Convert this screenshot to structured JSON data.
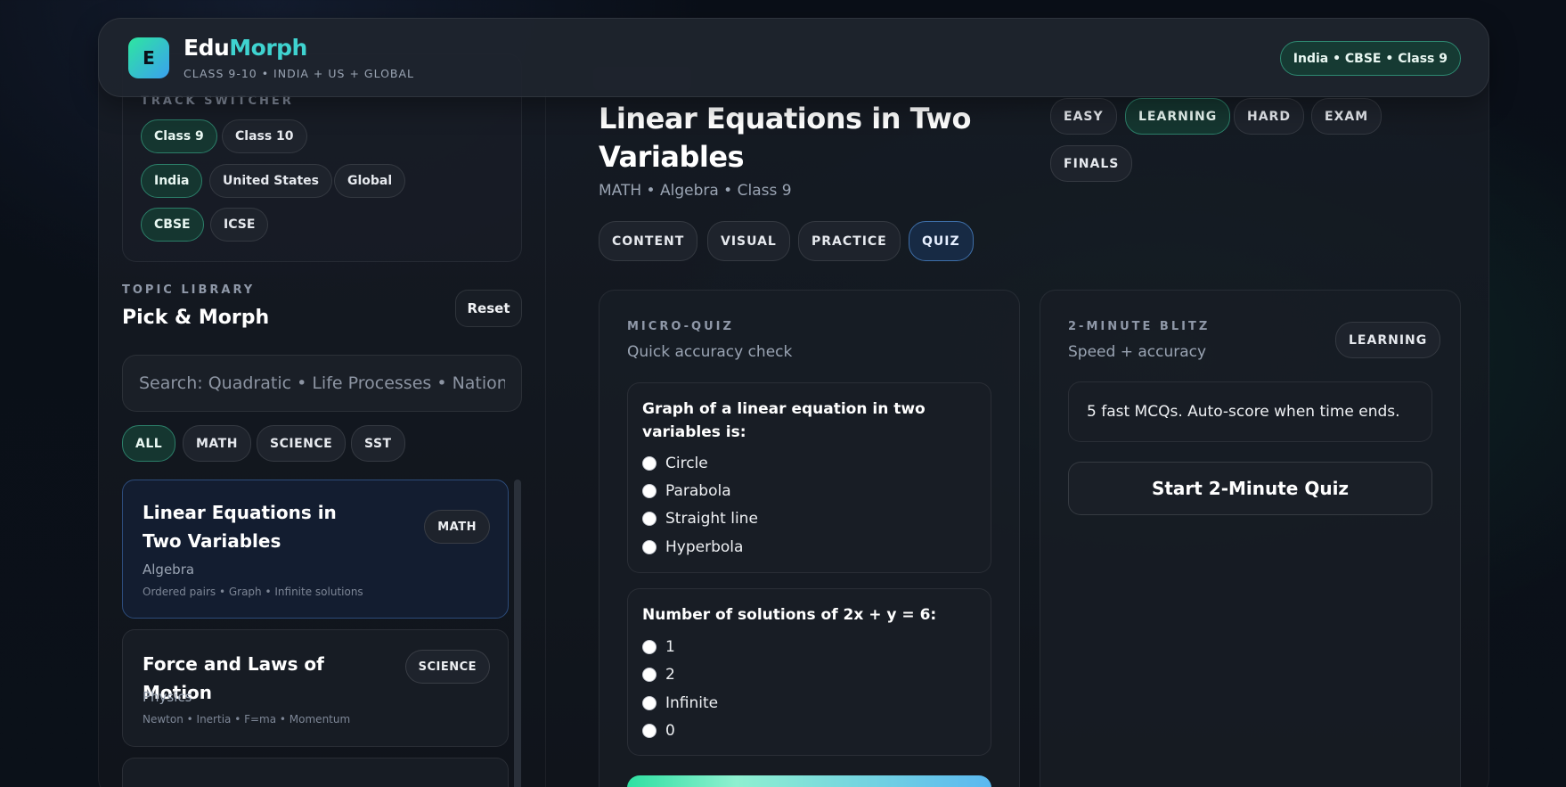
{
  "header": {
    "logo_letter": "E",
    "brand_part1": "Edu",
    "brand_part2": "Morph",
    "subtitle": "CLASS 9-10 • INDIA + US + GLOBAL",
    "location_pill": "India • CBSE • Class 9"
  },
  "sidebar": {
    "track_title": "TRACK SWITCHER",
    "classes": [
      "Class 9",
      "Class 10"
    ],
    "regions": [
      "India",
      "United States",
      "Global"
    ],
    "boards": [
      "CBSE",
      "ICSE"
    ],
    "library_label": "TOPIC LIBRARY",
    "library_title": "Pick & Morph",
    "reset_label": "Reset",
    "search_placeholder": "Search: Quadratic • Life Processes • National",
    "filters": [
      "ALL",
      "MATH",
      "SCIENCE",
      "SST"
    ],
    "topics": [
      {
        "title": "Linear Equations in Two Variables",
        "subject": "Algebra",
        "tags": "Ordered pairs • Graph • Infinite solutions",
        "badge": "MATH"
      },
      {
        "title": "Force and Laws of Motion",
        "subject": "Physics",
        "tags": "Newton • Inertia • F=ma • Momentum",
        "badge": "SCIENCE"
      }
    ]
  },
  "main": {
    "title": "Linear Equations in Two Variables",
    "subtitle": "MATH • Algebra • Class 9",
    "difficulty": [
      "EASY",
      "LEARNING",
      "HARD",
      "EXAM",
      "FINALS"
    ],
    "tabs": [
      "CONTENT",
      "VISUAL",
      "PRACTICE",
      "QUIZ"
    ],
    "micro_quiz": {
      "label": "MICRO-QUIZ",
      "sub": "Quick accuracy check",
      "questions": [
        {
          "q": "Graph of a linear equation in two variables is:",
          "options": [
            "Circle",
            "Parabola",
            "Straight line",
            "Hyperbola"
          ]
        },
        {
          "q": "Number of solutions of 2x + y = 6:",
          "options": [
            "1",
            "2",
            "Infinite",
            "0"
          ]
        }
      ]
    },
    "blitz": {
      "label": "2-MINUTE BLITZ",
      "sub": "Speed + accuracy",
      "badge": "LEARNING",
      "description": "5 fast MCQs. Auto-score when time ends.",
      "start_label": "Start 2-Minute Quiz"
    }
  }
}
